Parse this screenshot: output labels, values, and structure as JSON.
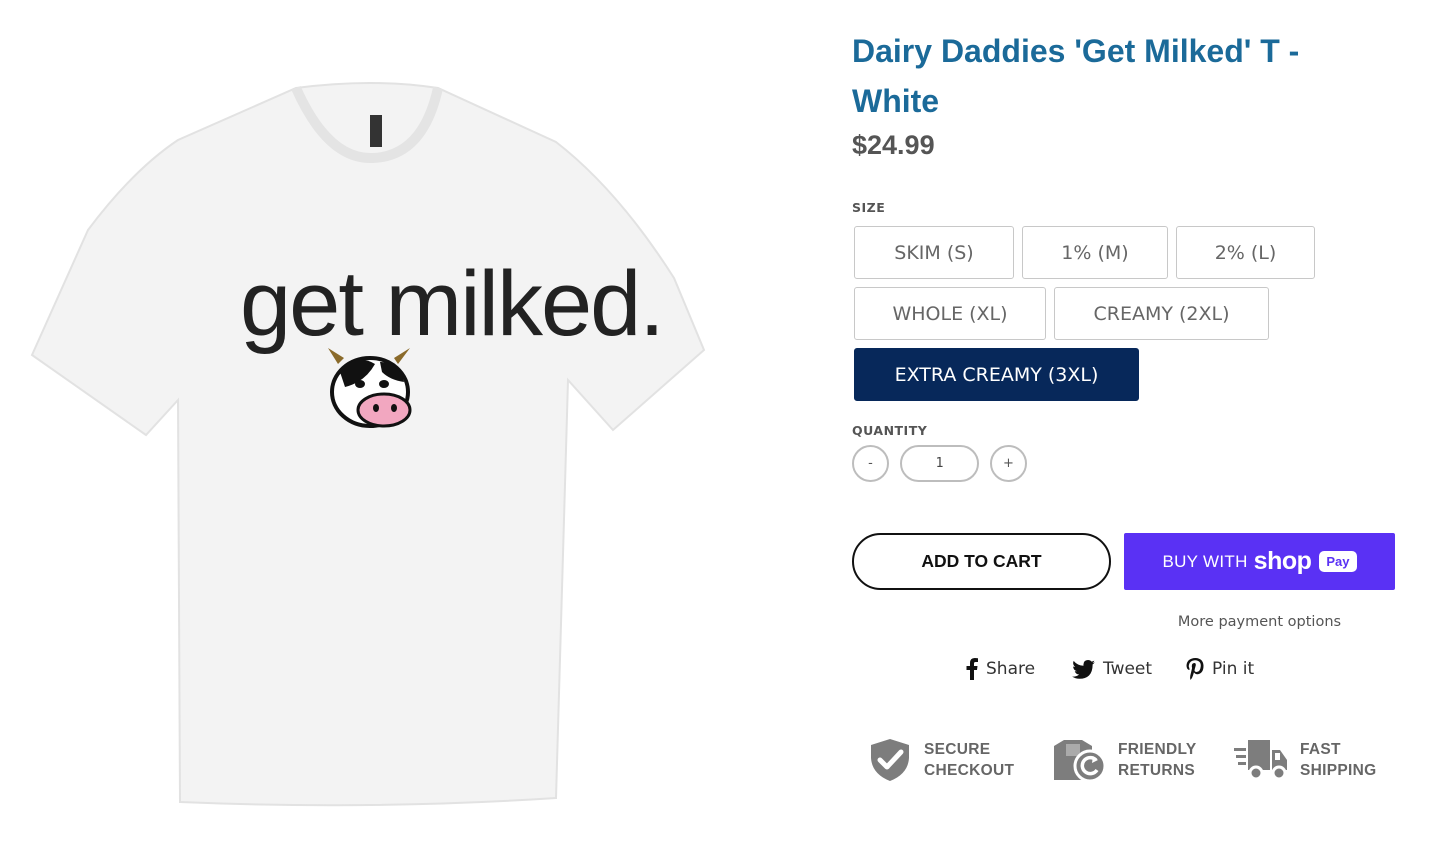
{
  "product": {
    "title": "Dairy Daddies 'Get Milked' T - White",
    "price": "$24.99",
    "shirt_print": "get milked."
  },
  "size": {
    "label": "SIZE",
    "options": [
      {
        "label": "SKIM (S)"
      },
      {
        "label": "1% (M)"
      },
      {
        "label": "2% (L)"
      },
      {
        "label": "WHOLE (XL)"
      },
      {
        "label": "CREAMY (2XL)"
      },
      {
        "label": "EXTRA CREAMY (3XL)"
      }
    ],
    "selected": "EXTRA CREAMY (3XL)"
  },
  "quantity": {
    "label": "QUANTITY",
    "value": "1",
    "decrement_label": "-",
    "increment_label": "+"
  },
  "cart": {
    "add_to_cart_label": "ADD TO CART",
    "buy_with_label": "BUY WITH",
    "shop_word": "shop",
    "pay_word": "Pay",
    "more_payment_options": "More payment options"
  },
  "social": {
    "share_label": "Share",
    "tweet_label": "Tweet",
    "pin_label": "Pin it"
  },
  "badges": [
    {
      "line1": "SECURE",
      "line2": "CHECKOUT",
      "icon": "shield-check-icon"
    },
    {
      "line1": "FRIENDLY",
      "line2": "RETURNS",
      "icon": "returns-box-icon"
    },
    {
      "line1": "FAST",
      "line2": "SHIPPING",
      "icon": "delivery-truck-icon"
    }
  ],
  "colors": {
    "title": "#1b6a99",
    "selected_option": "#07285a",
    "shop_pay": "#5a31f4"
  }
}
